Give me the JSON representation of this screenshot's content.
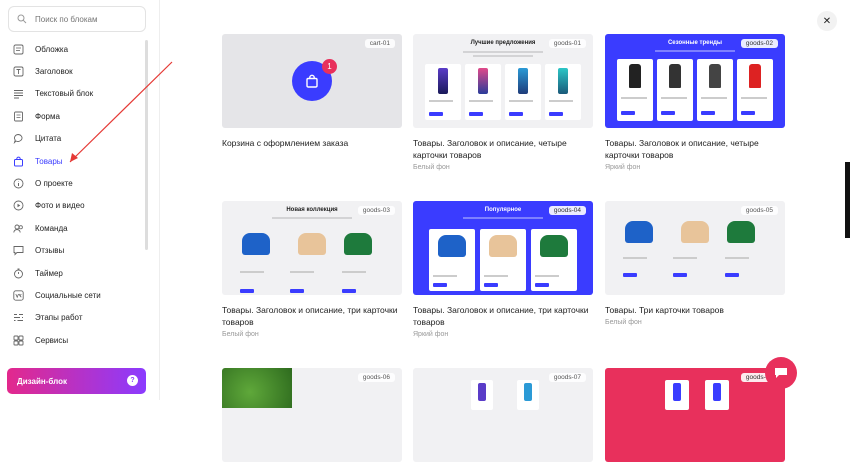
{
  "search": {
    "placeholder": "Поиск по блокам"
  },
  "sidebar": {
    "items": [
      {
        "label": "Обложка",
        "icon": "cover-icon"
      },
      {
        "label": "Заголовок",
        "icon": "text-t-icon"
      },
      {
        "label": "Текстовый блок",
        "icon": "paragraph-icon"
      },
      {
        "label": "Форма",
        "icon": "form-icon"
      },
      {
        "label": "Цитата",
        "icon": "quote-icon"
      },
      {
        "label": "Товары",
        "icon": "shopping-bag-icon"
      },
      {
        "label": "О проекте",
        "icon": "info-icon"
      },
      {
        "label": "Фото и видео",
        "icon": "play-icon"
      },
      {
        "label": "Команда",
        "icon": "team-icon"
      },
      {
        "label": "Отзывы",
        "icon": "review-icon"
      },
      {
        "label": "Таймер",
        "icon": "timer-icon"
      },
      {
        "label": "Социальные сети",
        "icon": "vk-icon"
      },
      {
        "label": "Этапы работ",
        "icon": "steps-icon"
      },
      {
        "label": "Сервисы",
        "icon": "services-icon"
      }
    ],
    "design_button": "Дизайн-блок",
    "help": "?"
  },
  "close": "✕",
  "accent": "#3a3cff",
  "cards": [
    {
      "tag": "cart-01",
      "title": "Корзина с оформлением заказа",
      "subtitle": "",
      "badge": "1"
    },
    {
      "tag": "goods-01",
      "title": "Товары. Заголовок и описание, четыре карточки товаров",
      "subtitle": "Белый фон",
      "heading": "Лучшие предложения"
    },
    {
      "tag": "goods-02",
      "title": "Товары. Заголовок и описание, четыре карточки товаров",
      "subtitle": "Яркий фон",
      "heading": "Сезонные тренды"
    },
    {
      "tag": "goods-03",
      "title": "Товары. Заголовок и описание, три карточки товаров",
      "subtitle": "Белый фон",
      "heading": "Новая коллекция"
    },
    {
      "tag": "goods-04",
      "title": "Товары. Заголовок и описание, три карточки товаров",
      "subtitle": "Яркий фон",
      "heading": "Популярное"
    },
    {
      "tag": "goods-05",
      "title": "Товары. Три карточки товаров",
      "subtitle": "Белый фон"
    },
    {
      "tag": "goods-06"
    },
    {
      "tag": "goods-07"
    },
    {
      "tag": "goods-08"
    }
  ]
}
